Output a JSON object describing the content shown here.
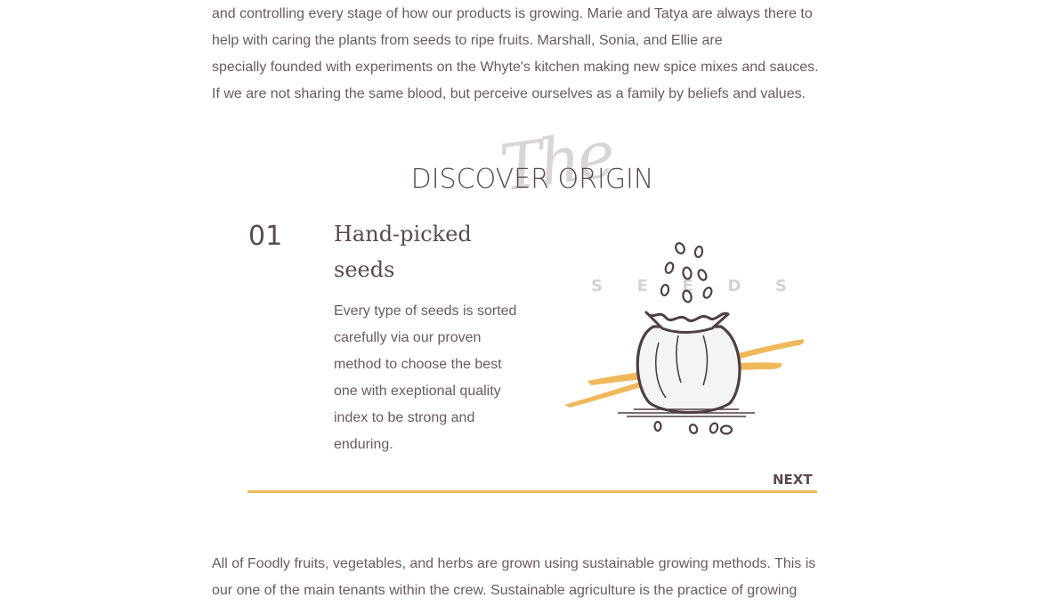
{
  "intro": {
    "lines": [
      "and controlling every stage of how our products is growing. Marie and Tatya are always there to",
      "help with caring the plants from seeds to ripe fruits. Marshall, Sonia, and Ellie are",
      "specially founded with experiments on the Whyte's kitchen making new spice mixes and sauces.",
      "If we are not sharing the same blood, but perceive ourselves as a family by beliefs and values."
    ]
  },
  "section": {
    "script_word": "The",
    "title": "DISCOVER ORIGIN"
  },
  "step": {
    "number": "01",
    "title_lines": [
      "Hand-picked",
      "seeds"
    ],
    "desc_lines": [
      "Every type of seeds is sorted",
      "carefully via our proven",
      "method to choose the best",
      "one with exeptional quality",
      "index to be strong and",
      "enduring."
    ],
    "word_letters": [
      "S",
      "E",
      "E",
      "D",
      "S"
    ],
    "illustration_icon": "seed-bag-icon"
  },
  "slider": {
    "next_label": "NEXT",
    "progress": 1.0
  },
  "outro": {
    "lines": [
      "All of Foodly fruits, vegetables, and herbs are grown using sustainable growing methods. This is",
      "our one of the main tenants within the crew. Sustainable agriculture is the practice of growing"
    ]
  },
  "colors": {
    "accent": "#efb95b",
    "text": "#6b5a5e",
    "heading": "#5a4a4e",
    "ink": "#4e3f43"
  }
}
